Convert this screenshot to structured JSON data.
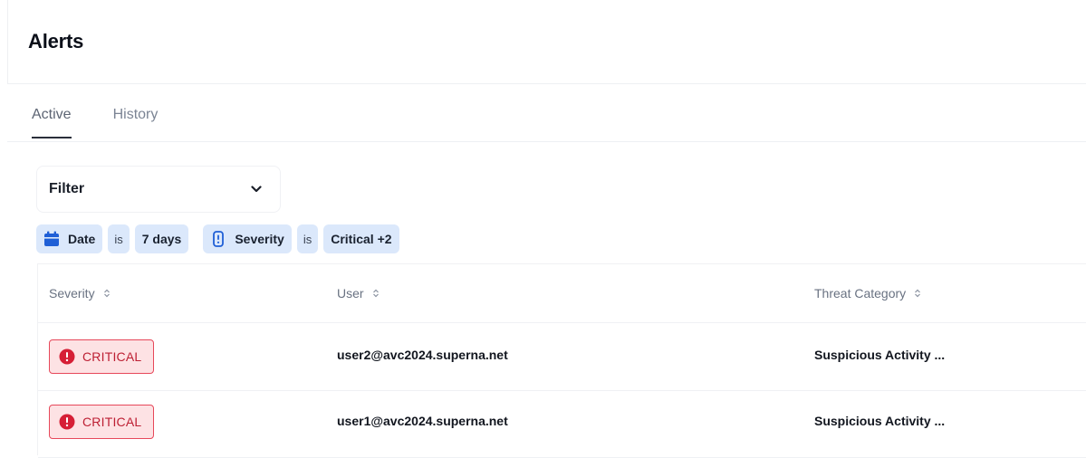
{
  "page": {
    "title": "Alerts"
  },
  "tabs": [
    {
      "label": "Active",
      "active": true
    },
    {
      "label": "History",
      "active": false
    }
  ],
  "filter": {
    "label": "Filter"
  },
  "chips": {
    "date_field": "Date",
    "date_op": "is",
    "date_value": "7 days",
    "severity_field": "Severity",
    "severity_op": "is",
    "severity_value": "Critical +2"
  },
  "table": {
    "columns": [
      "Severity",
      "User",
      "Threat Category"
    ],
    "rows": [
      {
        "severity": "CRITICAL",
        "user": "user2@avc2024.superna.net",
        "threat_category": "Suspicious Activity ..."
      },
      {
        "severity": "CRITICAL",
        "user": "user1@avc2024.superna.net",
        "threat_category": "Suspicious Activity ..."
      }
    ]
  },
  "icons": {
    "date": "calendar-icon",
    "severity": "shield-alert-icon",
    "critical": "alert-circle-icon",
    "sort": "sort-icon",
    "filter_toggle": "chevron-down-icon"
  },
  "colors": {
    "chip_bg": "#dbe8fb",
    "chip_icon": "#1f5fd6",
    "critical_bg": "#fde2e4",
    "critical_border": "#e7485a",
    "critical_text": "#bd1f33"
  }
}
